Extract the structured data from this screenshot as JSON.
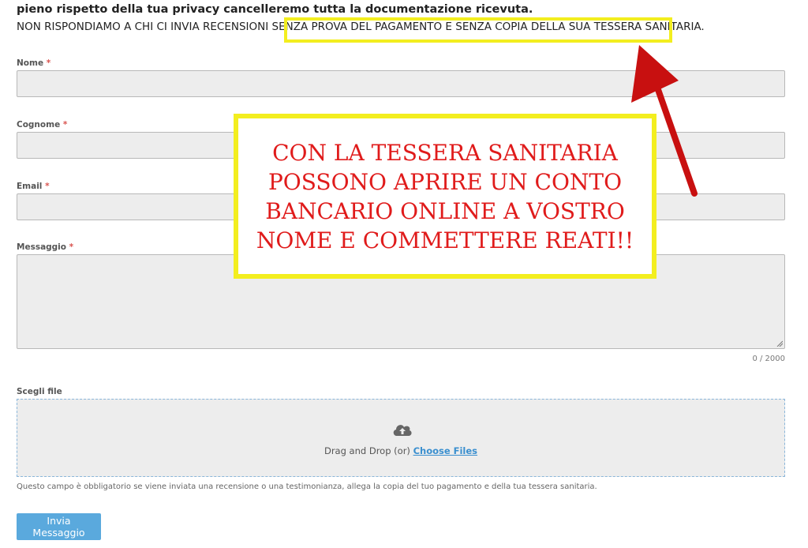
{
  "intro": {
    "bold_line": "pieno rispetto della tua privacy cancelleremo tutta la documentazione ricevuta.",
    "upper_line": "NON RISPONDIAMO A CHI CI INVIA RECENSIONI SENZA PROVA DEL PAGAMENTO E SENZA COPIA DELLA SUA TESSERA SANITARIA."
  },
  "form": {
    "required_mark": "*",
    "nome_label": "Nome",
    "cognome_label": "Cognome",
    "email_label": "Email",
    "messaggio_label": "Messaggio",
    "char_counter": "0 / 2000",
    "file_label": "Scegli file",
    "drop_text": "Drag and Drop (or)",
    "choose_files": "Choose Files",
    "help_text": "Questo campo è obbligatorio se viene inviata una recensione o una testimonianza, allega la copia del tuo pagamento e della tua tessera sanitaria.",
    "submit_label": "Invia Messaggio"
  },
  "warning": {
    "line1": "CON LA TESSERA SANITARIA",
    "line2": "POSSONO APRIRE UN CONTO",
    "line3": "BANCARIO ONLINE A VOSTRO",
    "line4": "NOME E COMMETTERE REATI!!"
  },
  "icons": {
    "upload": "cloud-upload-icon",
    "arrow": "red-arrow-icon"
  },
  "colors": {
    "highlight": "#f3ee1f",
    "warning_text": "#e01b1b",
    "accent": "#5aa9dd",
    "link": "#3a8fcf",
    "required": "#d9534f"
  }
}
